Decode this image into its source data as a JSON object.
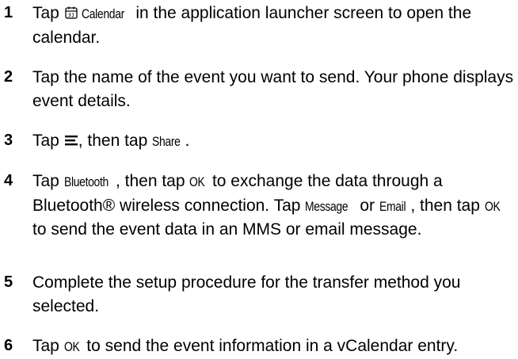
{
  "steps": [
    {
      "num": "1",
      "parts": {
        "a": "Tap ",
        "term": "Calendar",
        "b": " in the application launcher screen to open the calendar."
      }
    },
    {
      "num": "2",
      "parts": {
        "a": "Tap the name of the event you want to send. Your phone displays event details."
      }
    },
    {
      "num": "3",
      "parts": {
        "a": "Tap ",
        "b": ", then tap ",
        "term": "Share",
        "c": "."
      }
    },
    {
      "num": "4",
      "parts": {
        "a": "Tap ",
        "term1": "Bluetooth",
        "b": ", then tap ",
        "term2": "OK",
        "c": " to exchange the data through a Bluetooth® wireless connection. Tap ",
        "term3": "Message",
        "d": " or ",
        "term4": "Email",
        "e": ", then tap ",
        "term5": "OK",
        "f": " to send the event data in an MMS or email message."
      }
    },
    {
      "num": "5",
      "parts": {
        "a": "Complete the setup procedure for the transfer method you selected."
      }
    },
    {
      "num": "6",
      "parts": {
        "a": "Tap ",
        "term": "OK",
        "b": " to send the event information in a vCalendar entry."
      }
    }
  ],
  "icons": {
    "calendar": "calendar-icon",
    "menu": "menu-icon"
  }
}
